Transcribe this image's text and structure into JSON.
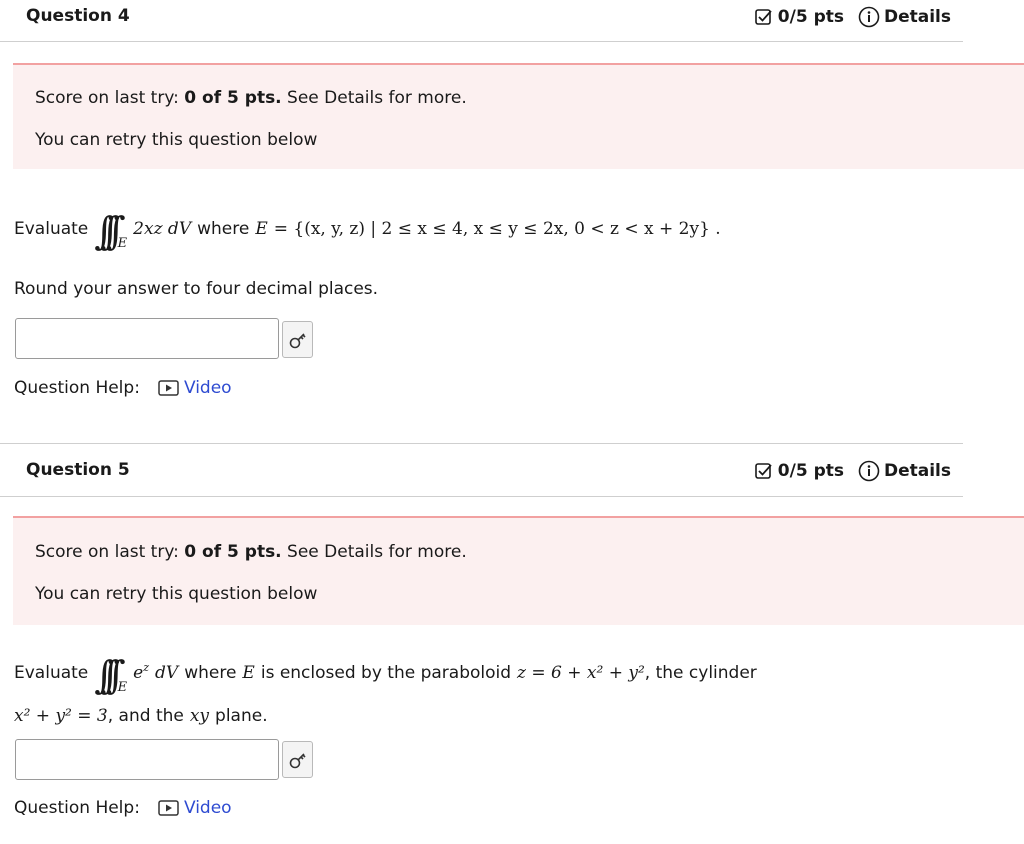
{
  "q4": {
    "title": "Question 4",
    "score": "0/5 pts",
    "details": "Details",
    "last_try_prefix": "Score on last try: ",
    "last_try_score": "0 of 5 pts.",
    "last_try_suffix": " See Details for more.",
    "retry": "You can retry this question below",
    "evaluate": "Evaluate",
    "integrand": "2xz dV",
    "where": "where",
    "region_var": "E",
    "region_def": "= {(x, y, z) | 2 ≤ x ≤ 4, x ≤ y ≤ 2x, 0 < z < x + 2y} .",
    "round": "Round your answer to four decimal places.",
    "answer_value": "",
    "help_label": "Question Help:",
    "video_label": "Video"
  },
  "q5": {
    "title": "Question 5",
    "score": "0/5 pts",
    "details": "Details",
    "last_try_prefix": "Score on last try: ",
    "last_try_score": "0 of 5 pts.",
    "last_try_suffix": " See Details for more.",
    "retry": "You can retry this question below",
    "evaluate": "Evaluate",
    "integrand_base": "e",
    "integrand_exp": "z",
    "integrand_tail": "dV",
    "where": "where",
    "region_var": "E",
    "enclosed": "is enclosed by the paraboloid",
    "paraboloid": "z = 6 + x² + y²",
    "cylinder_label": ", the cylinder",
    "cylinder": "x² + y² = 3",
    "plane_text": ", and the",
    "plane_var": "xy",
    "plane_end": "plane.",
    "answer_value": "",
    "help_label": "Question Help:",
    "video_label": "Video"
  },
  "icons": [
    "checkbox-check-icon",
    "info-circle-icon",
    "key-icon",
    "play-icon"
  ],
  "colors": {
    "accent_link": "#2e4bd1",
    "score_bg": "#fcf0f0",
    "score_border": "#f2a1a1"
  }
}
